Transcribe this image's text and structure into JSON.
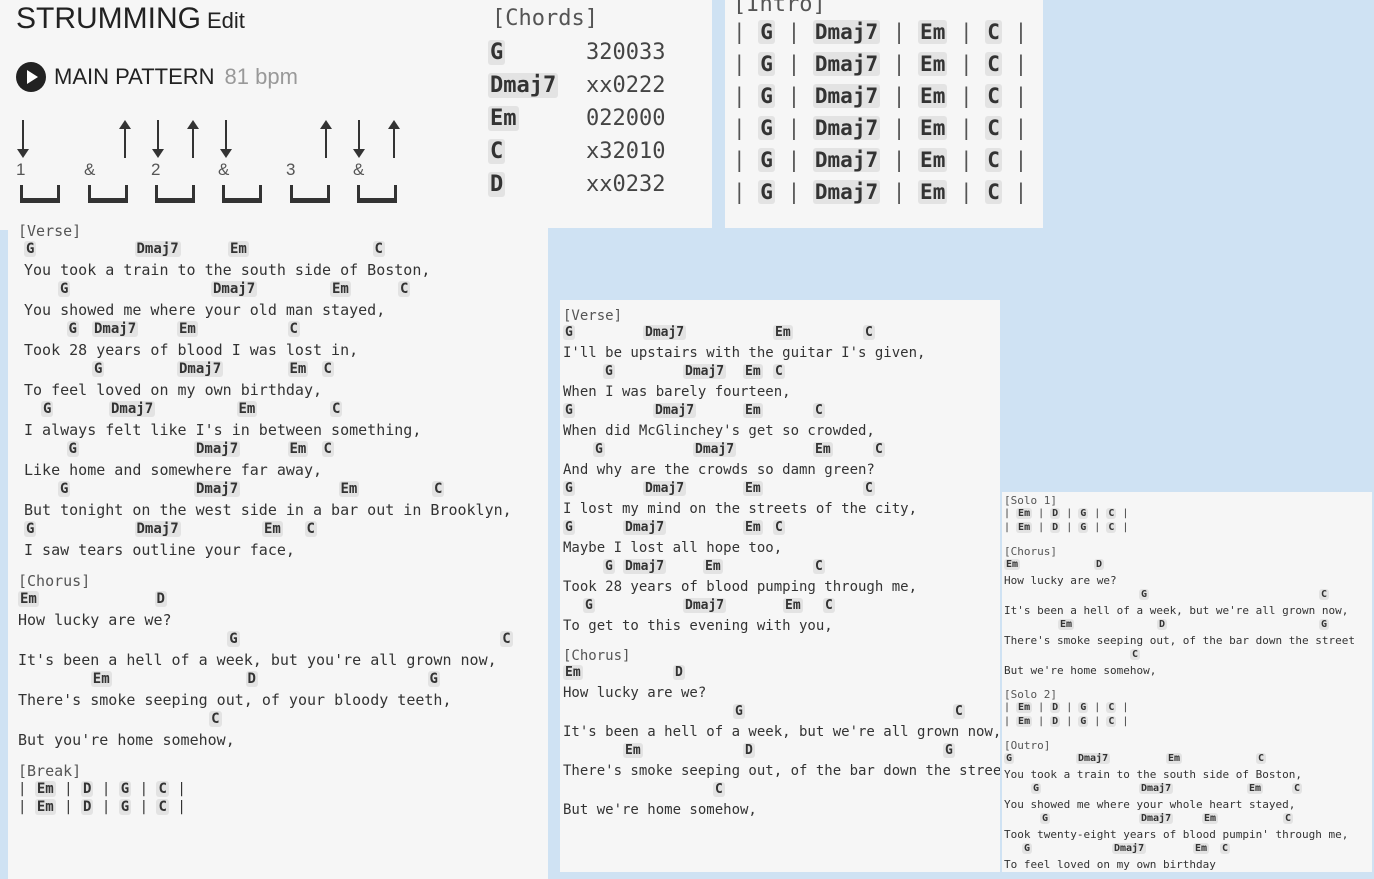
{
  "strumming": {
    "title": "STRUMMING",
    "edit": "Edit",
    "pattern_label": "MAIN PATTERN",
    "bpm": "81 bpm",
    "beats": [
      "1",
      "&",
      "2",
      "&",
      "3",
      "&"
    ]
  },
  "chords_box": {
    "header": "[Chords]",
    "rows": [
      {
        "name": "G",
        "fingering": "320033"
      },
      {
        "name": "Dmaj7",
        "fingering": "xx0222"
      },
      {
        "name": "Em",
        "fingering": "022000"
      },
      {
        "name": "C",
        "fingering": "x32010"
      },
      {
        "name": "D",
        "fingering": "xx0232"
      }
    ]
  },
  "intro": {
    "header": "[Intro]",
    "bars": [
      "G",
      "Dmaj7",
      "Em",
      "C"
    ],
    "repeat": 6
  },
  "left": {
    "verse": "[Verse]",
    "verse_lines": [
      {
        "c": [
          [
            "G",
            0
          ],
          [
            "Dmaj7",
            13
          ],
          [
            "Em",
            24
          ],
          [
            "C",
            41
          ]
        ],
        "l": "You took a train to the south side of Boston,"
      },
      {
        "c": [
          [
            "G",
            4
          ],
          [
            "Dmaj7",
            22
          ],
          [
            "Em",
            36
          ],
          [
            "C",
            44
          ]
        ],
        "l": "You showed me where your old man stayed,"
      },
      {
        "c": [
          [
            "G",
            5
          ],
          [
            "Dmaj7",
            8
          ],
          [
            "Em",
            18
          ],
          [
            "C",
            31
          ]
        ],
        "l": "Took 28 years of blood I was lost in,"
      },
      {
        "c": [
          [
            "G",
            8
          ],
          [
            "Dmaj7",
            18
          ],
          [
            "Em",
            31
          ],
          [
            "C",
            35
          ]
        ],
        "l": "To feel loved on my own birthday,"
      },
      {
        "c": [
          [
            "G",
            2
          ],
          [
            "Dmaj7",
            10
          ],
          [
            "Em",
            25
          ],
          [
            "C",
            36
          ]
        ],
        "l": "I always felt like I's in between something,"
      },
      {
        "c": [
          [
            "G",
            5
          ],
          [
            "Dmaj7",
            20
          ],
          [
            "Em",
            31
          ],
          [
            "C",
            35
          ]
        ],
        "l": "Like home and somewhere far away,"
      },
      {
        "c": [
          [
            "G",
            4
          ],
          [
            "Dmaj7",
            20
          ],
          [
            "Em",
            37
          ],
          [
            "C",
            48
          ]
        ],
        "l": "But tonight on the west side in a bar out in Brooklyn,"
      },
      {
        "c": [
          [
            "G",
            0
          ],
          [
            "Dmaj7",
            13
          ],
          [
            "Em",
            28
          ],
          [
            "C",
            33
          ]
        ],
        "l": "I saw tears outline your face,"
      }
    ],
    "chorus": "[Chorus]",
    "chorus_lines": [
      {
        "c": [
          [
            "Em",
            0
          ],
          [
            "D",
            15
          ]
        ],
        "l": "How lucky are we?"
      },
      {
        "c": [
          [
            "G",
            23
          ],
          [
            "C",
            53
          ]
        ],
        "l": "It's been a hell of a week, but you're all grown now,"
      },
      {
        "c": [
          [
            "Em",
            8
          ],
          [
            "D",
            25
          ],
          [
            "G",
            45
          ]
        ],
        "l": "There's smoke seeping out, of your bloody teeth,"
      },
      {
        "c": [
          [
            "C",
            21
          ]
        ],
        "l": "But you're home somehow,"
      }
    ],
    "break": "[Break]",
    "break_rows": [
      [
        "Em",
        "D",
        "G",
        "C"
      ],
      [
        "Em",
        "D",
        "G",
        "C"
      ]
    ]
  },
  "middle": {
    "verse": "[Verse]",
    "verse_lines": [
      {
        "c": [
          [
            "G",
            0
          ],
          [
            "Dmaj7",
            8
          ],
          [
            "Em",
            21
          ],
          [
            "C",
            30
          ]
        ],
        "l": "I'll be upstairs with the guitar I's given,"
      },
      {
        "c": [
          [
            "G",
            4
          ],
          [
            "Dmaj7",
            12
          ],
          [
            "Em",
            18
          ],
          [
            "C",
            21
          ]
        ],
        "l": "When I was barely fourteen,"
      },
      {
        "c": [
          [
            "G",
            0
          ],
          [
            "Dmaj7",
            9
          ],
          [
            "Em",
            18
          ],
          [
            "C",
            25
          ]
        ],
        "l": "When did McGlinchey's get so crowded,"
      },
      {
        "c": [
          [
            "G",
            3
          ],
          [
            "Dmaj7",
            13
          ],
          [
            "Em",
            25
          ],
          [
            "C",
            31
          ]
        ],
        "l": "And why are the crowds so damn green?"
      },
      {
        "c": [
          [
            "G",
            0
          ],
          [
            "Dmaj7",
            8
          ],
          [
            "Em",
            18
          ],
          [
            "C",
            30
          ]
        ],
        "l": "I lost my mind on the streets of the city,"
      },
      {
        "c": [
          [
            "G",
            0
          ],
          [
            "Dmaj7",
            6
          ],
          [
            "Em",
            18
          ],
          [
            "C",
            21
          ]
        ],
        "l": "Maybe I lost all hope too,"
      },
      {
        "c": [
          [
            "G",
            4
          ],
          [
            "Dmaj7",
            6
          ],
          [
            "Em",
            14
          ],
          [
            "C",
            25
          ]
        ],
        "l": "Took 28 years of blood pumping through me,"
      },
      {
        "c": [
          [
            "G",
            2
          ],
          [
            "Dmaj7",
            12
          ],
          [
            "Em",
            22
          ],
          [
            "C",
            26
          ]
        ],
        "l": "To get to this evening with you,"
      }
    ],
    "chorus": "[Chorus]",
    "chorus_lines": [
      {
        "c": [
          [
            "Em",
            0
          ],
          [
            "D",
            11
          ]
        ],
        "l": "How lucky are we?"
      },
      {
        "c": [
          [
            "G",
            17
          ],
          [
            "C",
            39
          ]
        ],
        "l": "It's been a hell of a week, but we're all grown now,"
      },
      {
        "c": [
          [
            "Em",
            6
          ],
          [
            "D",
            18
          ],
          [
            "G",
            38
          ]
        ],
        "l": "There's smoke seeping out, of the bar down the street"
      },
      {
        "c": [
          [
            "C",
            15
          ]
        ],
        "l": "But we're home somehow,"
      }
    ]
  },
  "right": {
    "solo1": "[Solo 1]",
    "solo1_rows": [
      [
        "Em",
        "D",
        "G",
        "C"
      ],
      [
        "Em",
        "D",
        "G",
        "C"
      ]
    ],
    "chorus": "[Chorus]",
    "chorus_lines": [
      {
        "c": [
          [
            "Em",
            0
          ],
          [
            "D",
            10
          ]
        ],
        "l": "How lucky are we?"
      },
      {
        "c": [
          [
            "G",
            15
          ],
          [
            "C",
            35
          ]
        ],
        "l": "It's been a hell of a week, but we're all grown now,"
      },
      {
        "c": [
          [
            "Em",
            6
          ],
          [
            "D",
            17
          ],
          [
            "G",
            35
          ]
        ],
        "l": "There's smoke seeping out, of the bar down the street"
      },
      {
        "c": [
          [
            "C",
            14
          ]
        ],
        "l": "But we're home somehow,"
      }
    ],
    "solo2": "[Solo 2]",
    "solo2_rows": [
      [
        "Em",
        "D",
        "G",
        "C"
      ],
      [
        "Em",
        "D",
        "G",
        "C"
      ]
    ],
    "outro": "[Outro]",
    "outro_lines": [
      {
        "c": [
          [
            "G",
            0
          ],
          [
            "Dmaj7",
            8
          ],
          [
            "Em",
            18
          ],
          [
            "C",
            28
          ]
        ],
        "l": "You took a train to the south side of Boston,"
      },
      {
        "c": [
          [
            "G",
            3
          ],
          [
            "Dmaj7",
            15
          ],
          [
            "Em",
            27
          ],
          [
            "C",
            32
          ]
        ],
        "l": "You showed me where your whole heart stayed,"
      },
      {
        "c": [
          [
            "G",
            4
          ],
          [
            "Dmaj7",
            15
          ],
          [
            "Em",
            22
          ],
          [
            "C",
            31
          ]
        ],
        "l": "Took twenty-eight years of blood pumpin' through me,"
      },
      {
        "c": [
          [
            "G",
            2
          ],
          [
            "Dmaj7",
            12
          ],
          [
            "Em",
            21
          ],
          [
            "C",
            24
          ]
        ],
        "l": "To feel loved on my own birthday"
      }
    ]
  }
}
